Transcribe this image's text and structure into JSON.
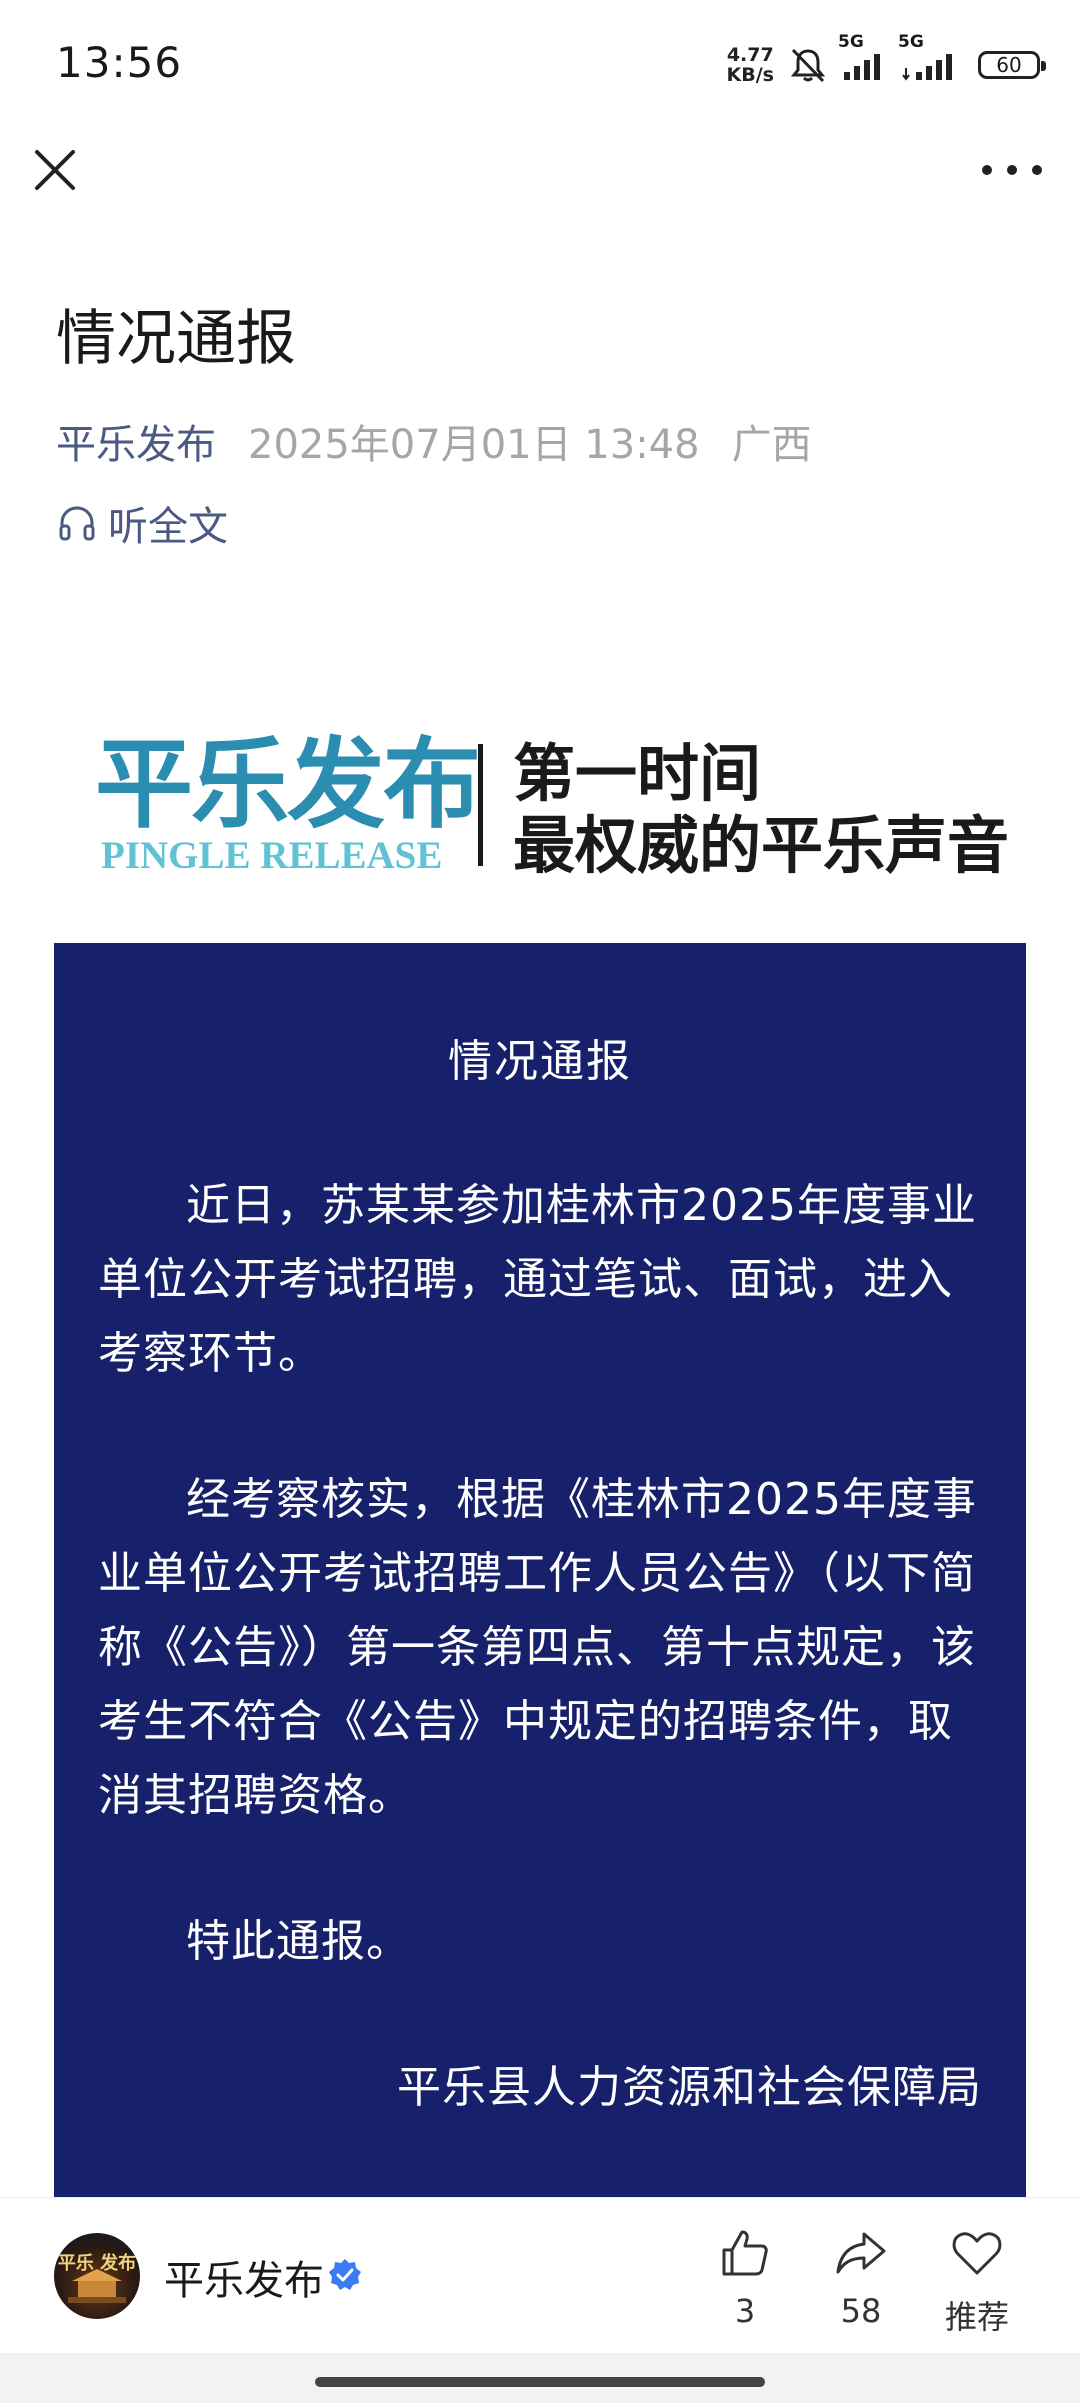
{
  "status_bar": {
    "time": "13:56",
    "net_speed_value": "4.77",
    "net_speed_unit": "KB/s",
    "sim1_label": "5G",
    "sim2_label": "5G",
    "battery": "60"
  },
  "article": {
    "title": "情况通报",
    "source": "平乐发布",
    "datetime": "2025年07月01日 13:48",
    "region": "广西",
    "listen_label": "听全文"
  },
  "banner": {
    "name_cn": "平乐发布",
    "name_en": "PINGLE RELEASE",
    "slogan_line1": "第一时间",
    "slogan_line2": "最权威的平乐声音"
  },
  "notice": {
    "title": "情况通报",
    "para1": "近日，苏某某参加桂林市2025年度事业单位公开考试招聘，通过笔试、面试，进入考察环节。",
    "para2": "经考察核实，根据《桂林市2025年度事业单位公开考试招聘工作人员公告》（以下简称《公告》）第一条第四点、第十点规定，该考生不符合《公告》中规定的招聘条件，取消其招聘资格。",
    "para3": "特此通报。",
    "signature": "平乐县人力资源和社会保障局"
  },
  "bottom_bar": {
    "account_name": "平乐发布",
    "avatar_text": "平乐 发布",
    "like_count": "3",
    "share_count": "58",
    "recommend_label": "推荐"
  },
  "colors": {
    "notice_bg": "#17206b",
    "source_blue": "#4a5a82",
    "verified_blue": "#3b7cf5",
    "banner_blue": "#2b8db0"
  }
}
